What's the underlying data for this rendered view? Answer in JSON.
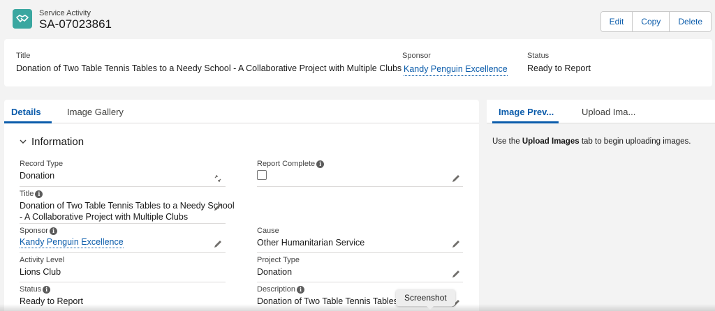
{
  "header": {
    "object_type": "Service Activity",
    "record_name": "SA-07023861",
    "icon": "handshake-icon",
    "buttons": {
      "edit": "Edit",
      "copy": "Copy",
      "delete": "Delete"
    },
    "accent_color": "#3aa7a0"
  },
  "highlights": {
    "title_label": "Title",
    "title_value": "Donation of Two Table Tennis Tables to a Needy School - A Collaborative Project with Multiple Clubs",
    "sponsor_label": "Sponsor",
    "sponsor_value": "Kandy Penguin Excellence",
    "status_label": "Status",
    "status_value": "Ready to Report"
  },
  "main": {
    "tabs": [
      "Details",
      "Image Gallery"
    ],
    "section_title": "Information",
    "fields": {
      "record_type": {
        "label": "Record Type",
        "value": "Donation"
      },
      "report_complete": {
        "label": "Report Complete",
        "checked": false
      },
      "title": {
        "label": "Title",
        "line1": "Donation of Two Table Tennis Tables to a Needy School",
        "line2": "- A Collaborative Project with Multiple Clubs"
      },
      "sponsor": {
        "label": "Sponsor",
        "value": "Kandy Penguin Excellence"
      },
      "cause": {
        "label": "Cause",
        "value": "Other Humanitarian Service"
      },
      "activity_level": {
        "label": "Activity Level",
        "value": "Lions Club"
      },
      "project_type": {
        "label": "Project Type",
        "value": "Donation"
      },
      "status": {
        "label": "Status",
        "value": "Ready to Report"
      },
      "description": {
        "label": "Description",
        "line1": "Donation of Two Table Tennis Tables to a"
      }
    }
  },
  "side": {
    "tabs": [
      "Image Prev...",
      "Upload Ima..."
    ],
    "hint_prefix": "Use the ",
    "hint_bold": "Upload Images",
    "hint_suffix": " tab to begin uploading images."
  },
  "tooltip": {
    "text": "Screenshot"
  }
}
